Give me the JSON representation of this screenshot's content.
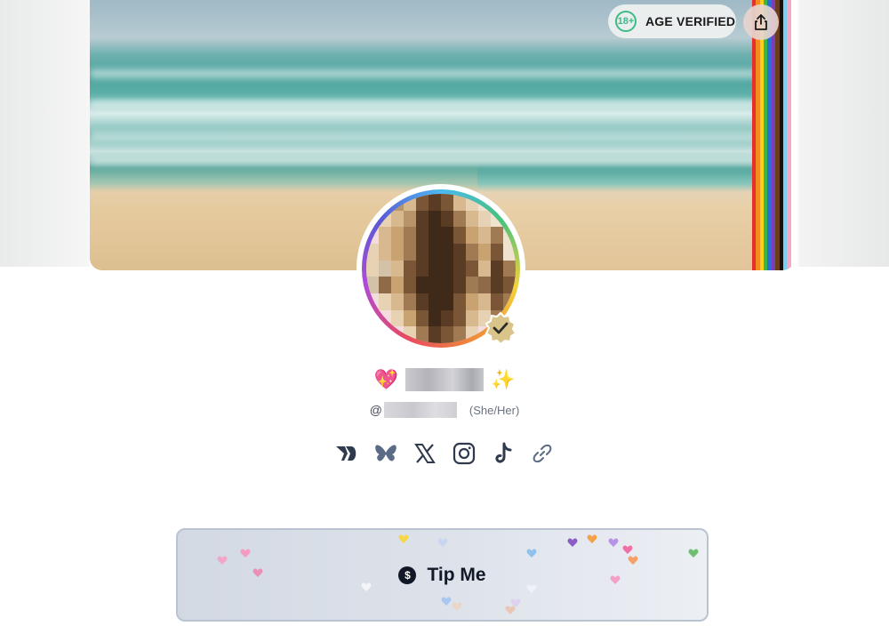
{
  "header": {
    "age_badge": {
      "number": "18+",
      "label": "AGE VERIFIED",
      "accent": "#3dbb86"
    },
    "share_icon": "share-icon"
  },
  "profile": {
    "emoji_left": "💖",
    "emoji_right": "✨",
    "at_sign": "@",
    "pronouns": "(She/Her)",
    "verified_icon": "verified-check-icon"
  },
  "socials": [
    {
      "icon": "substack-like-icon"
    },
    {
      "icon": "bluesky-icon"
    },
    {
      "icon": "x-icon"
    },
    {
      "icon": "instagram-icon"
    },
    {
      "icon": "tiktok-icon"
    },
    {
      "icon": "link-icon"
    }
  ],
  "tip": {
    "label": "Tip Me",
    "icon_glyph": "$"
  },
  "colors": {
    "pride": [
      "#e5312e",
      "#f58a1f",
      "#f6d31a",
      "#3bb54a",
      "#2a6fd6",
      "#7a3fb7",
      "#6b3d1f",
      "#111111",
      "#79d0f0",
      "#f4aac6",
      "#ffffff"
    ],
    "tip_border": "#b9c3d2",
    "text_dark": "#111827"
  }
}
